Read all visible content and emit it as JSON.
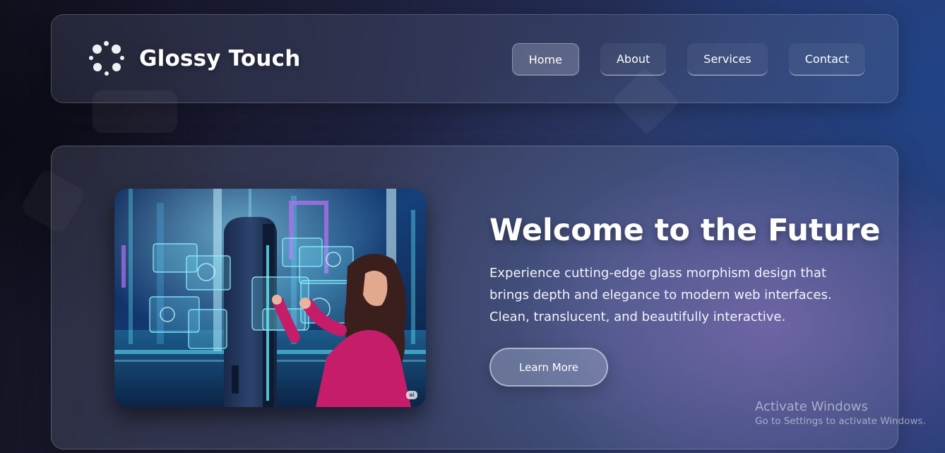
{
  "brand": {
    "name": "Glossy Touch",
    "logo_icon": "dots-circle-icon"
  },
  "nav": {
    "items": [
      {
        "label": "Home",
        "active": true
      },
      {
        "label": "About",
        "active": false
      },
      {
        "label": "Services",
        "active": false
      },
      {
        "label": "Contact",
        "active": false
      }
    ]
  },
  "hero": {
    "title": "Welcome to the Future",
    "text": "Experience cutting-edge glass morphism design that brings depth and elegance to modern web interfaces. Clean, translucent, and beautifully interactive.",
    "button_label": "Learn More",
    "image_badge": "ai"
  },
  "watermark": {
    "title": "Activate Windows",
    "subtitle": "Go to Settings to activate Windows."
  },
  "colors": {
    "accent": "#2a3f7a",
    "text": "#ffffff",
    "image_pink": "#c51d6a",
    "image_cyan": "#5fe8ff"
  }
}
